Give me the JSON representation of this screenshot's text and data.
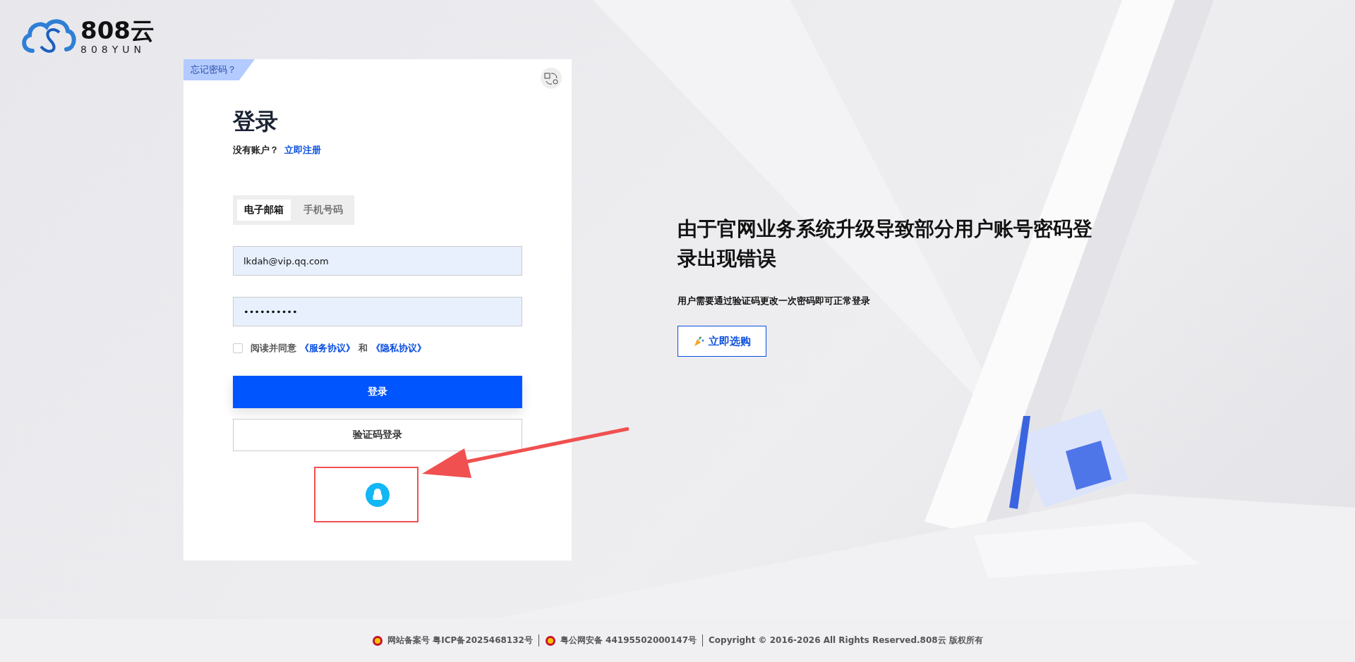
{
  "logo": {
    "name": "808云",
    "subtitle": "808YUN"
  },
  "login_card": {
    "corner_tab": "忘记密码？",
    "title": "登录",
    "register_prompt": "没有账户？",
    "register_link": "立即注册",
    "tabs": [
      {
        "label": "电子邮箱",
        "selected": true
      },
      {
        "label": "手机号码",
        "selected": false
      }
    ],
    "email_field": {
      "value": "lkdah@vip.qq.com"
    },
    "password_field": {
      "value": "••••••••••"
    },
    "agreement": {
      "checked": false,
      "prefix": "阅读并同意",
      "link_1": "《服务协议》",
      "connector": "和",
      "link_2": "《隐私协议》"
    },
    "login_button": "登录",
    "code_login_button": "验证码登录"
  },
  "notice": {
    "heading": "由于官网业务系统升级导致部分用户账号密码登录出现错误",
    "text": "用户需要通过验证码更改一次密码即可正常登录",
    "button": "立即选购"
  },
  "footer": {
    "items": [
      "网站备案号 粤ICP备2025468132号",
      "粤公网安备 44195502000147号",
      "Copyright © 2016-2026 All Rights Reserved.808云 版权所有"
    ]
  }
}
